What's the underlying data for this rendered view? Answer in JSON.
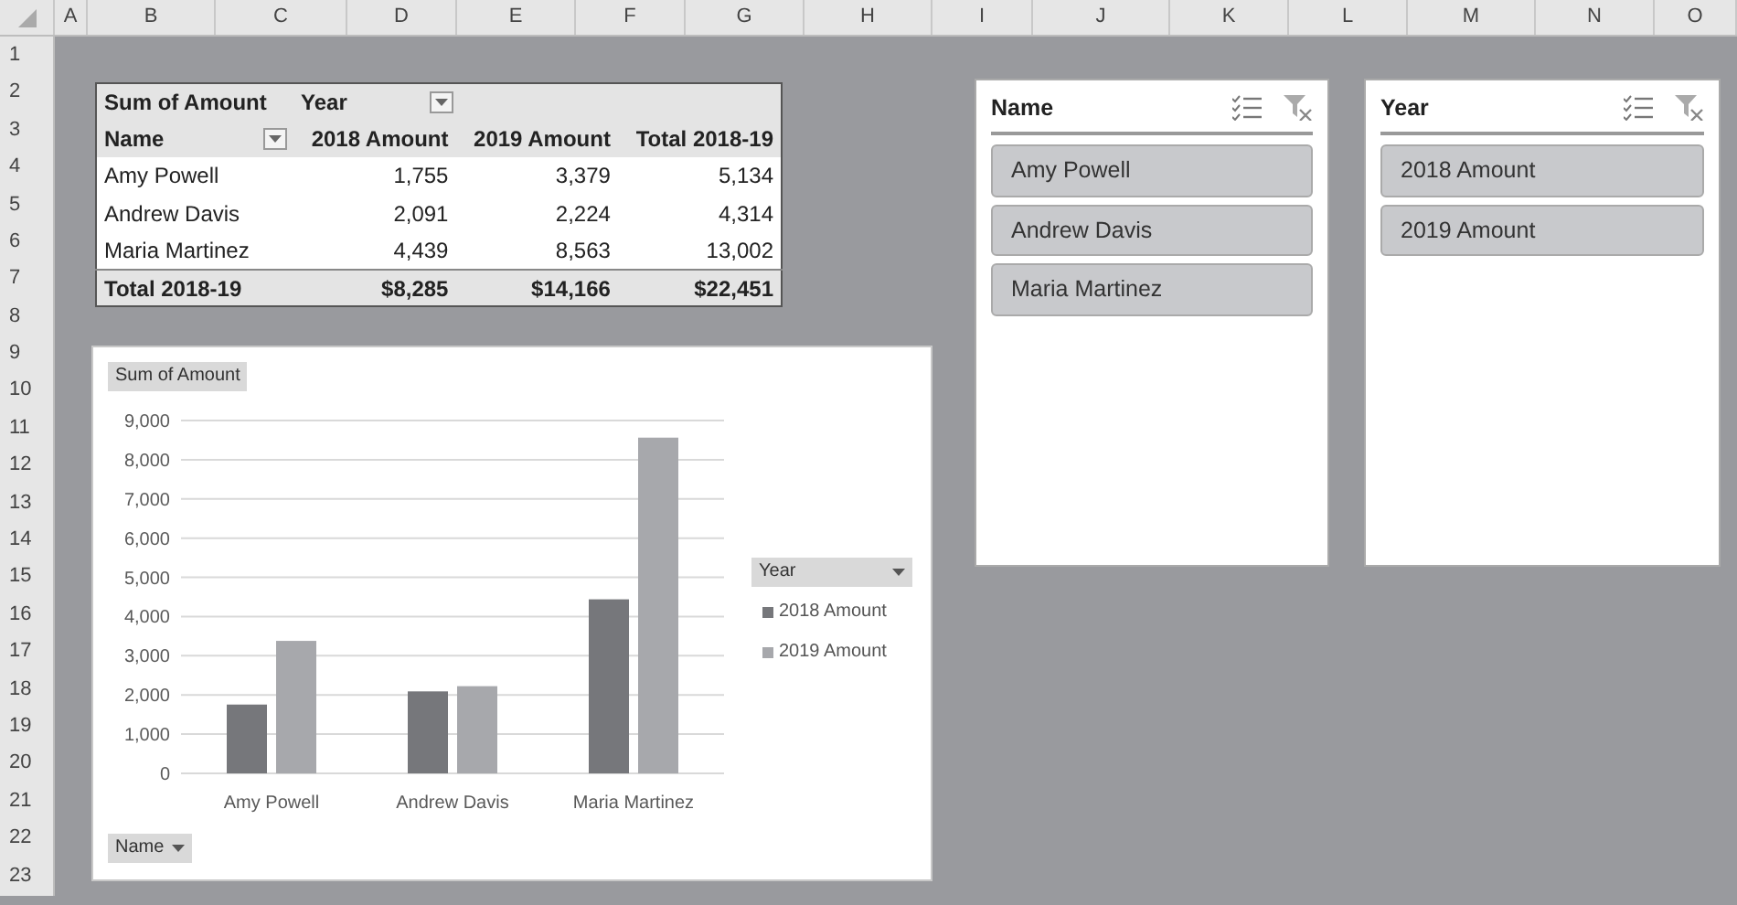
{
  "columns": [
    "A",
    "B",
    "C",
    "D",
    "E",
    "F",
    "G",
    "H",
    "I",
    "J",
    "K",
    "L",
    "M",
    "N",
    "O"
  ],
  "rows": [
    "1",
    "2",
    "3",
    "4",
    "5",
    "6",
    "7",
    "8",
    "9",
    "10",
    "11",
    "12",
    "13",
    "14",
    "15",
    "16",
    "17",
    "18",
    "19",
    "20",
    "21",
    "22",
    "23"
  ],
  "pivot_table": {
    "value_label": "Sum of Amount",
    "column_field": "Year",
    "headers": [
      "Name",
      "2018 Amount",
      "2019 Amount",
      "Total 2018-19"
    ],
    "rows": [
      [
        "Amy Powell",
        "1,755",
        "3,379",
        "5,134"
      ],
      [
        "Andrew Davis",
        "2,091",
        "2,224",
        "4,314"
      ],
      [
        "Maria Martinez",
        "4,439",
        "8,563",
        "13,002"
      ]
    ],
    "total_row": [
      "Total 2018-19",
      "$8,285",
      "$14,166",
      "$22,451"
    ]
  },
  "chart": {
    "value_button": "Sum of Amount",
    "axis_button": "Name",
    "legend_button": "Year",
    "chart_data": {
      "type": "bar",
      "categories": [
        "Amy Powell",
        "Andrew Davis",
        "Maria Martinez"
      ],
      "series": [
        {
          "name": "2018 Amount",
          "color": "#76777b",
          "values": [
            1755,
            2091,
            4439
          ]
        },
        {
          "name": "2019 Amount",
          "color": "#a7a8ac",
          "values": [
            3379,
            2224,
            8563
          ]
        }
      ],
      "ylim": [
        0,
        9000
      ],
      "grid": true,
      "legend": true,
      "yticks": [
        {
          "value": 0,
          "label": "0"
        },
        {
          "value": 1000,
          "label": "1,000"
        },
        {
          "value": 2000,
          "label": "2,000"
        },
        {
          "value": 3000,
          "label": "3,000"
        },
        {
          "value": 4000,
          "label": "4,000"
        },
        {
          "value": 5000,
          "label": "5,000"
        },
        {
          "value": 6000,
          "label": "6,000"
        },
        {
          "value": 7000,
          "label": "7,000"
        },
        {
          "value": 8000,
          "label": "8,000"
        },
        {
          "value": 9000,
          "label": "9,000"
        }
      ]
    }
  },
  "slicers": [
    {
      "title": "Name",
      "items": [
        {
          "label": "Amy Powell",
          "selected": true
        },
        {
          "label": "Andrew Davis",
          "selected": true
        },
        {
          "label": "Maria Martinez",
          "selected": true
        }
      ]
    },
    {
      "title": "Year",
      "items": [
        {
          "label": "2018 Amount",
          "selected": true
        },
        {
          "label": "2019 Amount",
          "selected": true
        }
      ]
    }
  ]
}
